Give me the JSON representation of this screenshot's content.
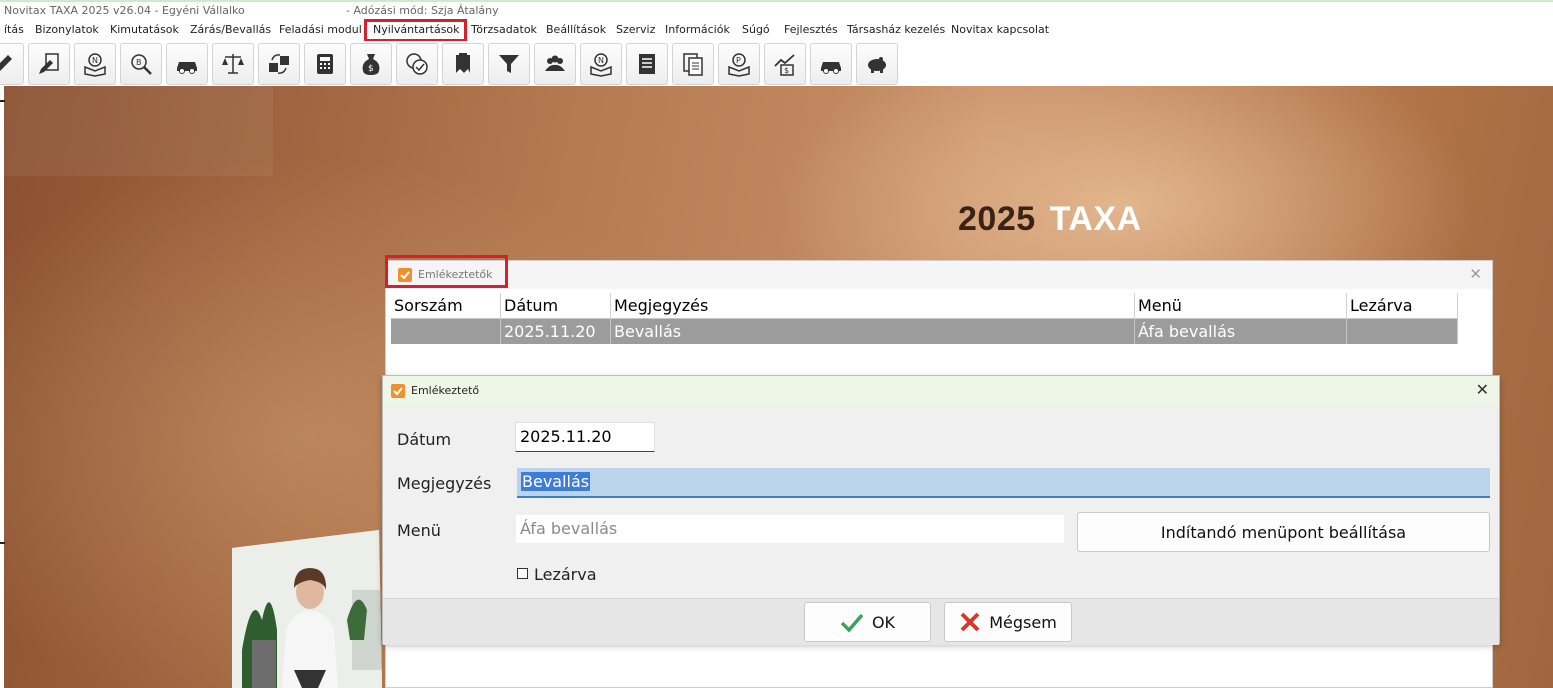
{
  "window": {
    "title": "Novitax TAXA 2025 v26.04 - Egyéni Vállalkozó",
    "mode": "- Adózási mód: Szja Átalány"
  },
  "menu": [
    "ítás",
    "Bizonylatok",
    "Kimutatások",
    "Zárás/Bevallás",
    "Feladási modul",
    "Nyilvántartások",
    "Törzsadatok",
    "Beállítások",
    "Szerviz",
    "Információk",
    "Súgó",
    "Fejlesztés",
    "Társasház kezelés",
    "Novitax kapcsolat"
  ],
  "toolbar_icons": [
    "pencil-icon",
    "edit-document-icon",
    "n-book-icon",
    "b-search-icon",
    "car-icon",
    "scales-icon",
    "transfer-boxes-icon",
    "calculator-icon",
    "money-bag-icon",
    "coin-check-icon",
    "stamp-icon",
    "funnel-icon",
    "people-icon",
    "n-book2-icon",
    "document-list-icon",
    "documents-icon",
    "p-book-icon",
    "chart-dollar-icon",
    "car2-icon",
    "piggy-bank-icon"
  ],
  "brand": {
    "year": "2025",
    "name": "TAXA"
  },
  "reminders": {
    "title": "Emlékeztetők",
    "columns": [
      "Sorszám",
      "Dátum",
      "Megjegyzés",
      "Menü",
      "Lezárva"
    ],
    "rows": [
      {
        "sorszam": "",
        "datum": "2025.11.20",
        "megjegyzes": "Bevallás",
        "menu": "Áfa bevallás",
        "lezarva": ""
      }
    ]
  },
  "dialog": {
    "title": "Emlékeztető",
    "date_label": "Dátum",
    "date_value": "2025.11.20",
    "note_label": "Megjegyzés",
    "note_value": "Bevallás",
    "menu_label": "Menü",
    "menu_value": "Áfa bevallás",
    "set_menu_button": "Indítandó menüpont beállítása",
    "closed_label": "Lezárva",
    "closed_checked": false,
    "ok_label": "OK",
    "cancel_label": "Mégsem"
  },
  "colors": {
    "highlight": "#d8202a",
    "selection": "#3d7dd8",
    "ok_green": "#3aa35a",
    "cancel_red": "#d43a2a"
  }
}
